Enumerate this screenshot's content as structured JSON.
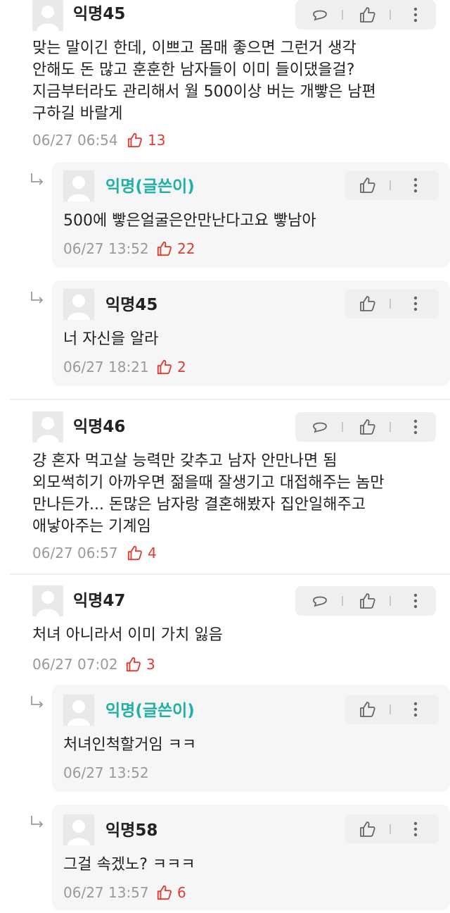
{
  "comments": [
    {
      "name": "익명45",
      "lines": [
        "맞는 말이긴 한데, 이쁘고 몸매 좋으면 그런거 생각",
        "안해도 돈 많고 훈훈한 남자들이 이미 들이댔을걸?",
        "지금부터라도 관리해서 월 500이상 버는 개빻은 남편",
        "구하길 바랄게"
      ],
      "date": "06/27 06:54",
      "likes": "13",
      "replies": [
        {
          "name": "익명(글쓴이)",
          "text": "500에 빻은얼굴은안만난다고요 빻남아",
          "date": "06/27 13:52",
          "likes": "22"
        },
        {
          "name": "익명45",
          "text": "너 자신을 알라",
          "date": "06/27 18:21",
          "likes": "2"
        }
      ]
    },
    {
      "name": "익명46",
      "lines": [
        "걍 혼자 먹고살 능력만 갖추고 남자 안만나면 됨",
        "외모썩히기 아까우면 젊을때 잘생기고 대접해주는 놈만",
        "만나든가... 돈많은 남자랑 결혼해봤자 집안일해주고",
        "애낳아주는 기계임"
      ],
      "date": "06/27 06:57",
      "likes": "4"
    },
    {
      "name": "익명47",
      "lines": [
        "처녀 아니라서 이미 가치 잃음"
      ],
      "date": "06/27 07:02",
      "likes": "3",
      "replies": [
        {
          "name": "익명(글쓴이)",
          "text": "처녀인척할거임 ㅋㅋ",
          "date": "06/27 13:52",
          "likes": ""
        },
        {
          "name": "익명58",
          "text": "그걸 속겠노? ㅋㅋㅋ",
          "date": "06/27 13:57",
          "likes": "6"
        }
      ]
    }
  ],
  "icons": {
    "comment": "speech-bubble-icon",
    "like": "thumbs-up-icon",
    "more": "vertical-dots-icon",
    "reply": "reply-arrow-icon"
  },
  "colors": {
    "author": "#1fb0a7",
    "likes": "#e23a2e",
    "meta": "#9a9a9a",
    "reply_bg": "#f6f6f6",
    "actions_bg": "#efefef"
  }
}
